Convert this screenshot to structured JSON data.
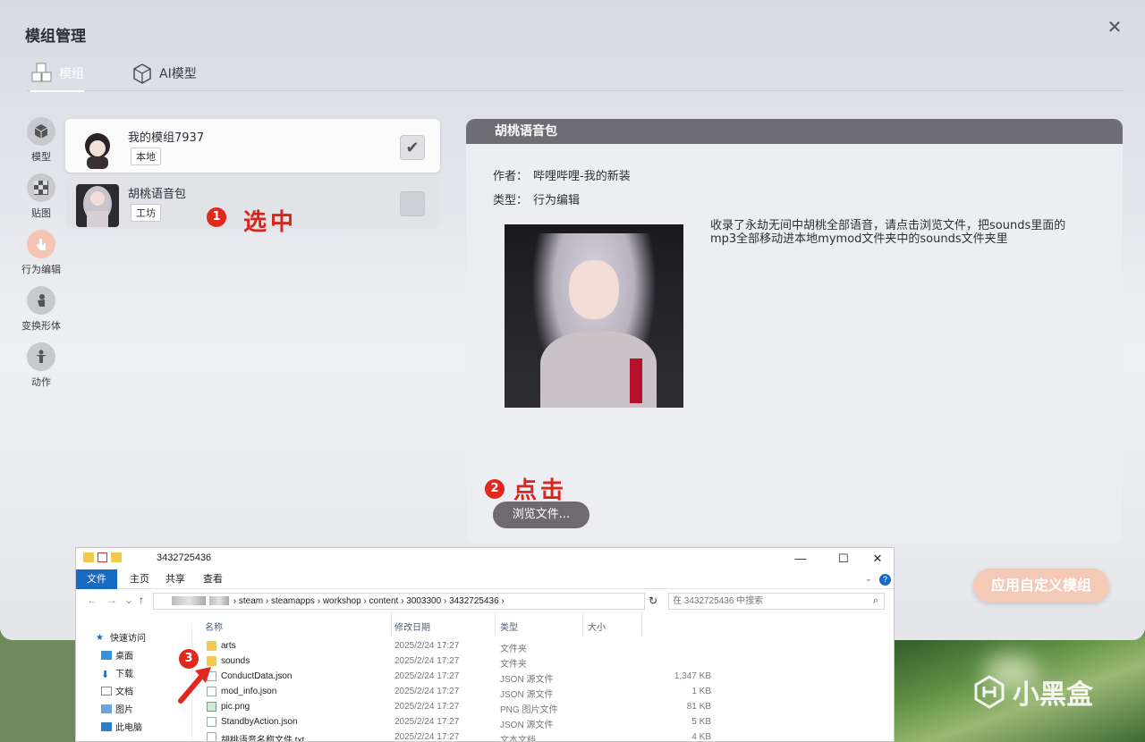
{
  "app": {
    "title": "模组管理",
    "close": "✕"
  },
  "tabs": [
    {
      "label": "模组",
      "icon": "cubes-icon"
    },
    {
      "label": "AI模型",
      "icon": "ai-cube-icon"
    }
  ],
  "categories": [
    {
      "label": "模型",
      "icon": "cube-icon"
    },
    {
      "label": "贴图",
      "icon": "checker-icon"
    },
    {
      "label": "行为编辑",
      "icon": "hand-icon"
    },
    {
      "label": "变换形体",
      "icon": "body-icon"
    },
    {
      "label": "动作",
      "icon": "figure-icon"
    }
  ],
  "mods": [
    {
      "name": "我的模组7937",
      "tag": "本地",
      "checked": true
    },
    {
      "name": "胡桃语音包",
      "tag": "工坊",
      "checked": false
    }
  ],
  "annotations": {
    "a1_num": "1",
    "a1_text": "选中",
    "a2_num": "2",
    "a2_text": "点击",
    "a3_num": "3"
  },
  "detail": {
    "title": "胡桃语音包",
    "author_label": "作者：",
    "author_value": "哔哩哔哩-我的新装",
    "type_label": "类型：",
    "type_value": "行为编辑",
    "description": "收录了永劫无间中胡桃全部语音，请点击浏览文件，把sounds里面的mp3全部移动进本地mymod文件夹中的sounds文件夹里",
    "browse_button": "浏览文件..."
  },
  "apply_button": "应用自定义模组",
  "explorer": {
    "title": "3432725436",
    "ribbon": [
      "文件",
      "主页",
      "共享",
      "查看"
    ],
    "minimize": "—",
    "maximize": "☐",
    "close": "✕",
    "help": "?",
    "path": [
      "steam",
      "steamapps",
      "workshop",
      "content",
      "3003300",
      "3432725436"
    ],
    "search_placeholder": "在 3432725436 中搜索",
    "nav": [
      "快速访问",
      "桌面",
      "下载",
      "文档",
      "图片",
      "此电脑"
    ],
    "columns": [
      "名称",
      "修改日期",
      "类型",
      "大小"
    ],
    "files": [
      {
        "name": "arts",
        "date": "2025/2/24 17:27",
        "type": "文件夹",
        "size": "",
        "kind": "folder"
      },
      {
        "name": "sounds",
        "date": "2025/2/24 17:27",
        "type": "文件夹",
        "size": "",
        "kind": "folder"
      },
      {
        "name": "ConductData.json",
        "date": "2025/2/24 17:27",
        "type": "JSON 源文件",
        "size": "1,347 KB",
        "kind": "file"
      },
      {
        "name": "mod_info.json",
        "date": "2025/2/24 17:27",
        "type": "JSON 源文件",
        "size": "1 KB",
        "kind": "file"
      },
      {
        "name": "pic.png",
        "date": "2025/2/24 17:27",
        "type": "PNG 图片文件",
        "size": "81 KB",
        "kind": "img"
      },
      {
        "name": "StandbyAction.json",
        "date": "2025/2/24 17:27",
        "type": "JSON 源文件",
        "size": "5 KB",
        "kind": "file"
      },
      {
        "name": "胡桃语音名称文件.txt",
        "date": "2025/2/24 17:27",
        "type": "文本文档",
        "size": "4 KB",
        "kind": "file"
      }
    ]
  },
  "watermark": "小黑盒",
  "colors": {
    "accent_red": "#e0281f",
    "header_gray": "#6e6d73",
    "apply_peach": "#f4c9b5",
    "explorer_blue": "#1a69c0"
  }
}
